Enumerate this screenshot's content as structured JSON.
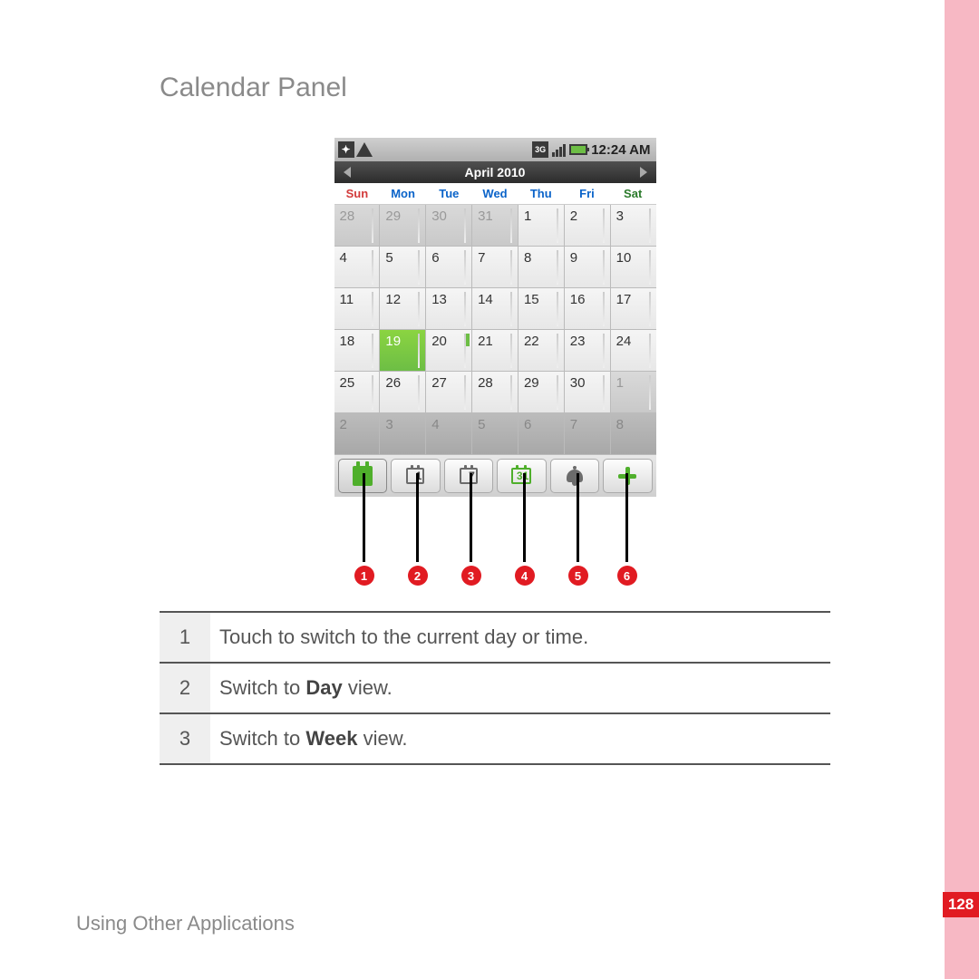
{
  "page": {
    "title": "Calendar Panel",
    "footer": "Using Other Applications",
    "number": "128"
  },
  "status": {
    "time": "12:24 AM"
  },
  "calendar": {
    "month_label": "April 2010",
    "day_names": [
      "Sun",
      "Mon",
      "Tue",
      "Wed",
      "Thu",
      "Fri",
      "Sat"
    ],
    "today": 19,
    "event_day": 20,
    "rows": [
      {
        "cells": [
          {
            "n": "28",
            "faded": true
          },
          {
            "n": "29",
            "faded": true
          },
          {
            "n": "30",
            "faded": true
          },
          {
            "n": "31",
            "faded": true
          },
          {
            "n": "1"
          },
          {
            "n": "2"
          },
          {
            "n": "3"
          }
        ]
      },
      {
        "cells": [
          {
            "n": "4"
          },
          {
            "n": "5"
          },
          {
            "n": "6"
          },
          {
            "n": "7"
          },
          {
            "n": "8"
          },
          {
            "n": "9"
          },
          {
            "n": "10"
          }
        ]
      },
      {
        "cells": [
          {
            "n": "11"
          },
          {
            "n": "12"
          },
          {
            "n": "13"
          },
          {
            "n": "14"
          },
          {
            "n": "15"
          },
          {
            "n": "16"
          },
          {
            "n": "17"
          }
        ]
      },
      {
        "cells": [
          {
            "n": "18"
          },
          {
            "n": "19",
            "today": true
          },
          {
            "n": "20",
            "event": true
          },
          {
            "n": "21"
          },
          {
            "n": "22"
          },
          {
            "n": "23"
          },
          {
            "n": "24"
          }
        ]
      },
      {
        "cells": [
          {
            "n": "25"
          },
          {
            "n": "26"
          },
          {
            "n": "27"
          },
          {
            "n": "28"
          },
          {
            "n": "29"
          },
          {
            "n": "30"
          },
          {
            "n": "1",
            "faded": true
          }
        ]
      },
      {
        "cells": [
          {
            "n": "2",
            "shadow": true
          },
          {
            "n": "3",
            "shadow": true
          },
          {
            "n": "4",
            "shadow": true
          },
          {
            "n": "5",
            "shadow": true
          },
          {
            "n": "6",
            "shadow": true
          },
          {
            "n": "7",
            "shadow": true
          },
          {
            "n": "8",
            "shadow": true
          }
        ]
      }
    ]
  },
  "toolbar": {
    "day_label": "1",
    "week_label": "7",
    "month_label": "31"
  },
  "callouts": [
    "1",
    "2",
    "3",
    "4",
    "5",
    "6"
  ],
  "legend": [
    {
      "num": "1",
      "text": "Touch to switch to the current day or time."
    },
    {
      "num": "2",
      "pre": "Switch to ",
      "bold": "Day",
      "post": " view."
    },
    {
      "num": "3",
      "pre": "Switch to ",
      "bold": "Week",
      "post": " view."
    }
  ]
}
